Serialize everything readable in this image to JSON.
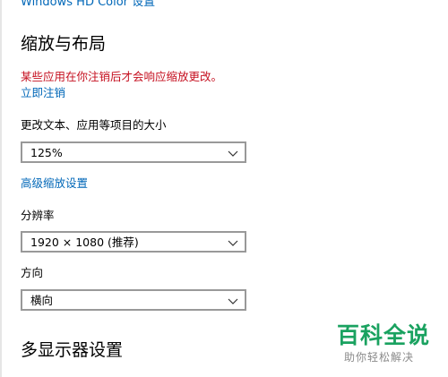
{
  "header_link": "Windows HD Color 设置",
  "scale_layout": {
    "title": "缩放与布局",
    "warning": "某些应用在你注销后才会响应缩放更改。",
    "signout_link": "立即注销",
    "text_size_label": "更改文本、应用等项目的大小",
    "text_size_value": "125%",
    "advanced_link": "高级缩放设置",
    "resolution_label": "分辨率",
    "resolution_value": "1920 × 1080 (推荐)",
    "orientation_label": "方向",
    "orientation_value": "横向"
  },
  "multi_display": {
    "title": "多显示器设置"
  },
  "watermark": {
    "main": "百科全说",
    "sub": "助你轻松解决"
  },
  "colors": {
    "link": "#0067b8",
    "warning": "#c50f1f",
    "watermark": "#1aa260"
  }
}
